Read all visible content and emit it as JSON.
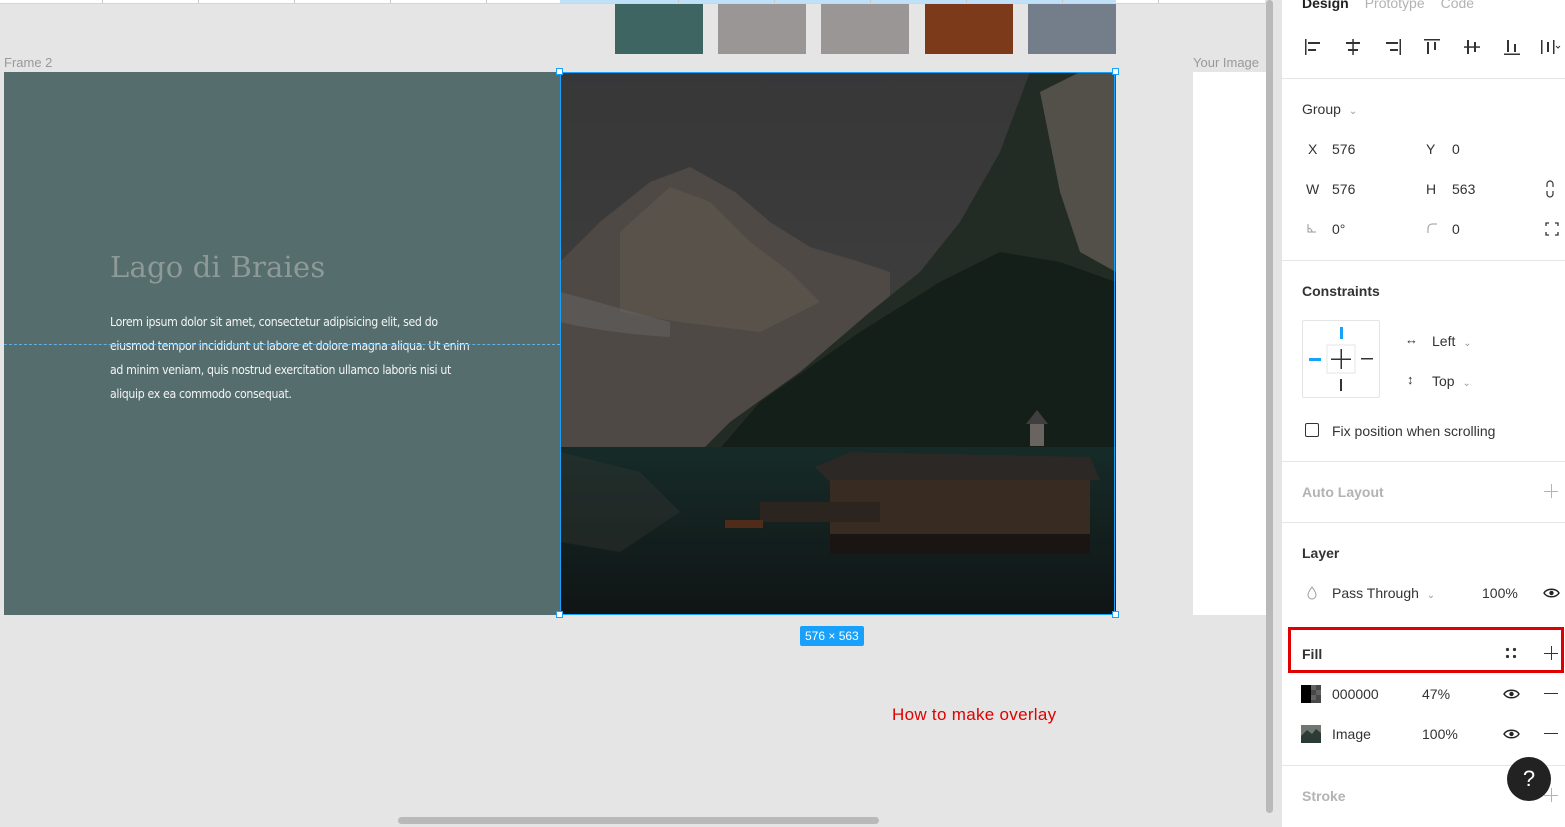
{
  "canvas": {
    "frame_label": "Frame 2",
    "your_image_label": "Your Image",
    "hero": {
      "title": "Lago di Braies",
      "body": "Lorem ipsum dolor sit amet, consectetur adipisicing elit, sed do eiusmod tempor incididunt ut labore et dolore magna aliqua. Ut enim ad minim veniam, quis nostrud exercitation ullamco laboris nisi ut aliquip ex ea commodo consequat."
    },
    "swatches": [
      "#3f6563",
      "#9a9696",
      "#9a9696",
      "#7d3a1a",
      "#737e8a"
    ],
    "dimension_badge": "576 × 563",
    "annotation": "How to make overlay",
    "accent_color": "#18a0fb"
  },
  "panel": {
    "tabs": [
      {
        "label": "Design",
        "active": true
      },
      {
        "label": "Prototype",
        "active": false
      },
      {
        "label": "Code",
        "active": false
      }
    ],
    "group_label": "Group",
    "x_label": "X",
    "x_value": "576",
    "y_label": "Y",
    "y_value": "0",
    "w_label": "W",
    "w_value": "576",
    "h_label": "H",
    "h_value": "563",
    "rotation_value": "0°",
    "radius_value": "0",
    "constraints": {
      "title": "Constraints",
      "horizontal": "Left",
      "vertical": "Top",
      "fix_position_label": "Fix position when scrolling"
    },
    "auto_layout_title": "Auto Layout",
    "layer": {
      "title": "Layer",
      "blend_mode": "Pass Through",
      "opacity": "100%"
    },
    "fill": {
      "title": "Fill",
      "items": [
        {
          "label": "000000",
          "opacity": "47%",
          "icon": "black-swatch-icon"
        },
        {
          "label": "Image",
          "opacity": "100%",
          "icon": "image-thumb-icon"
        }
      ]
    },
    "stroke_title": "Stroke",
    "help_label": "?"
  }
}
